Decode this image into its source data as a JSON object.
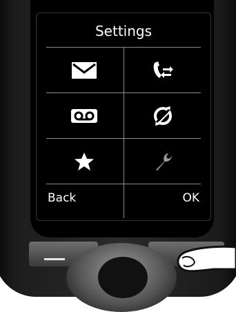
{
  "screen": {
    "title": "Settings",
    "items": [
      {
        "icon": "envelope-icon",
        "interactable": true
      },
      {
        "icon": "call-transfer-icon",
        "interactable": true
      },
      {
        "icon": "voicemail-icon",
        "interactable": true
      },
      {
        "icon": "eco-mode-icon",
        "interactable": true
      },
      {
        "icon": "star-icon",
        "interactable": true
      },
      {
        "icon": "wrench-icon",
        "interactable": true
      }
    ],
    "softkeys": {
      "left": "Back",
      "right": "OK"
    }
  },
  "colors": {
    "screen_bg": "#000000",
    "foreground": "#ffffff",
    "divider": "#8a8a8a",
    "wrench_gray": "#9a9a9a"
  }
}
